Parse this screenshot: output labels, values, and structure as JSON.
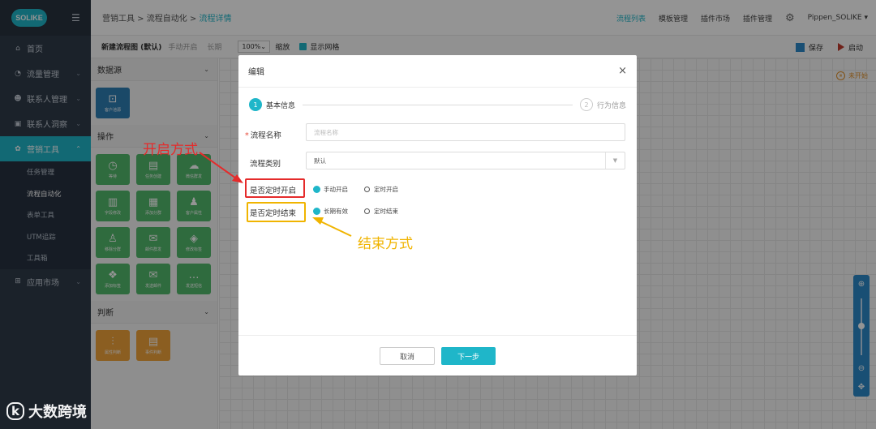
{
  "sidebar": {
    "logo_text": "SOLIKE",
    "menu": [
      {
        "icon": "home-icon",
        "glyph": "⌂",
        "label": "首页"
      },
      {
        "icon": "pie-chart-icon",
        "glyph": "◔",
        "label": "流量管理"
      },
      {
        "icon": "users-icon",
        "glyph": "☻",
        "label": "联系人管理"
      },
      {
        "icon": "id-card-icon",
        "glyph": "▣",
        "label": "联系人洞察"
      },
      {
        "icon": "cluster-icon",
        "glyph": "✿",
        "label": "营销工具"
      }
    ],
    "submenu": [
      "任务管理",
      "流程自动化",
      "表单工具",
      "UTM追踪",
      "工具箱"
    ],
    "app_market": {
      "icon": "cart-icon",
      "glyph": "⊞",
      "label": "应用市场"
    }
  },
  "topnav": {
    "crumb_1": "营销工具",
    "crumb_2": "流程自动化",
    "crumb_3": "流程详情",
    "sep": " > ",
    "links": [
      "流程列表",
      "模板管理",
      "插件市场",
      "插件管理"
    ],
    "user": "Pippen_SOLIKE"
  },
  "toolbar": {
    "title": "新建流程图 (默认)",
    "mode": "手动开启",
    "term": "长期",
    "zoom": "100%",
    "zoom_label": "缩放",
    "grid_label": "显示网格",
    "save": "保存",
    "start": "启动"
  },
  "panel": {
    "sections": [
      "数据源",
      "操作",
      "判断"
    ],
    "datasource_tiles": [
      {
        "icon": "contact-source-icon",
        "glyph": "⊡",
        "label": "客户池源"
      }
    ],
    "action_tiles": [
      {
        "icon": "clock-icon",
        "glyph": "◷",
        "label": "等待"
      },
      {
        "icon": "calendar-icon",
        "glyph": "▤",
        "label": "任务创建"
      },
      {
        "icon": "wechat-icon",
        "glyph": "☁",
        "label": "微信群发"
      },
      {
        "icon": "columns-icon",
        "glyph": "▥",
        "label": "字段修改"
      },
      {
        "icon": "user-add-icon",
        "glyph": "▦",
        "label": "添加分群"
      },
      {
        "icon": "user-icon",
        "glyph": "♟",
        "label": "客户属性"
      },
      {
        "icon": "tag-user-icon",
        "glyph": "♙",
        "label": "移除分群"
      },
      {
        "icon": "mail-icon",
        "glyph": "✉",
        "label": "邮件群发"
      },
      {
        "icon": "tag-icon",
        "glyph": "◈",
        "label": "修改标签"
      },
      {
        "icon": "label-icon",
        "glyph": "❖",
        "label": "添加标签"
      },
      {
        "icon": "envelope-icon",
        "glyph": "✉",
        "label": "发送邮件"
      },
      {
        "icon": "sms-icon",
        "glyph": "…",
        "label": "发送短信"
      }
    ],
    "judge_tiles": [
      {
        "icon": "sliders-icon",
        "glyph": "⫶",
        "label": "属性判断"
      },
      {
        "icon": "doc-icon",
        "glyph": "▤",
        "label": "事件判断"
      }
    ]
  },
  "canvas": {
    "status": "未开始"
  },
  "modal": {
    "title": "编辑",
    "step1_num": "1",
    "step1": "基本信息",
    "step2_num": "2",
    "step2": "行为信息",
    "name_label": "流程名称",
    "name_placeholder": "流程名称",
    "type_label": "流程类别",
    "type_value": "默认",
    "timed_start_label": "是否定时开启",
    "start_opt_1": "手动开启",
    "start_opt_2": "定时开启",
    "timed_end_label": "是否定时结束",
    "end_opt_1": "长期有效",
    "end_opt_2": "定时结束",
    "cancel": "取消",
    "next": "下一步"
  },
  "annotations": {
    "start_mode": "开启方式",
    "end_mode": "结束方式"
  },
  "watermark": {
    "logo": "k",
    "text": "大数跨境"
  },
  "colors": {
    "accent": "#1fb6c9",
    "sidebar": "#2f3b49",
    "annotation_red": "#e52b2b",
    "annotation_yellow": "#f0b400"
  }
}
